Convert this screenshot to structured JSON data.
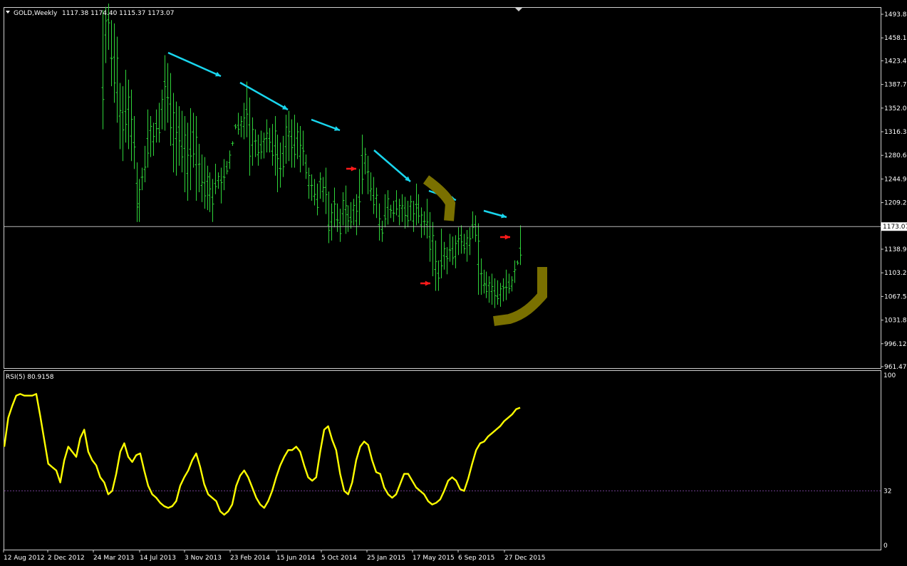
{
  "header": {
    "symbol": "GOLD,Weekly",
    "ohlc": "1117.38 1174.40 1115.37 1173.07"
  },
  "colors": {
    "background": "#000000",
    "bars": "#2fd43a",
    "trend_arrows": "#19d6ee",
    "signal_arrows": "#ff1a1a",
    "highlight_shapes": "#7a7000",
    "rsi_line": "#ffff00",
    "level_line": "#6a3a8a",
    "price_line": "#b8b8b8",
    "frame": "#cfcfcf"
  },
  "price_panel": {
    "current_price_label": "1173.07",
    "icons": [
      "dropdown-triangle-icon",
      "scroll-marker-icon"
    ]
  },
  "rsi_panel": {
    "title": "RSI(5) 80.9158"
  },
  "x_axis_labels": [
    "12 Aug 2012",
    "2 Dec 2012",
    "24 Mar 2013",
    "14 Jul 2013",
    "3 Nov 2013",
    "23 Feb 2014",
    "15 Jun 2014",
    "5 Oct 2014",
    "25 Jan 2015",
    "17 May 2015",
    "6 Sep 2015",
    "27 Dec 2015"
  ],
  "chart_data": [
    {
      "type": "bar",
      "title": "GOLD,Weekly",
      "subtitle": "1117.38 1174.40 1115.37 1173.07",
      "y_ticks": [
        "1493.82",
        "1458.12",
        "1423.47",
        "1387.75",
        "1352.07",
        "1316.37",
        "1280.67",
        "1244.97",
        "1209.27",
        "1173.07",
        "1138.92",
        "1103.22",
        "1067.52",
        "1031.82",
        "996.12",
        "961.47"
      ],
      "ylim": [
        961.47,
        1493.82
      ],
      "current_price": 1173.07,
      "grid": false,
      "x_start_label": "12 Aug 2012",
      "x_end_label": "27 Dec 2015",
      "highs": [
        1500,
        1505,
        1510,
        1485,
        1480,
        1460,
        1390,
        1385,
        1410,
        1395,
        1380,
        1340,
        1270,
        1245,
        1262,
        1295,
        1350,
        1340,
        1330,
        1350,
        1360,
        1380,
        1432,
        1420,
        1405,
        1375,
        1362,
        1355,
        1348,
        1340,
        1330,
        1352,
        1345,
        1340,
        1298,
        1282,
        1278,
        1265,
        1255,
        1245,
        1268,
        1255,
        1262,
        1275,
        1272,
        1288,
        1302,
        1328,
        1345,
        1340,
        1360,
        1392,
        1368,
        1338,
        1320,
        1312,
        1318,
        1315,
        1335,
        1322,
        1328,
        1340,
        1312,
        1300,
        1310,
        1342,
        1348,
        1335,
        1342,
        1330,
        1325,
        1318,
        1282,
        1262,
        1252,
        1245,
        1238,
        1255,
        1248,
        1262,
        1226,
        1208,
        1232,
        1208,
        1200,
        1225,
        1235,
        1205,
        1210,
        1215,
        1222,
        1260,
        1312,
        1292,
        1280,
        1255,
        1248,
        1232,
        1208,
        1182,
        1222,
        1228,
        1206,
        1212,
        1228,
        1215,
        1222,
        1218,
        1212,
        1220,
        1212,
        1238,
        1222,
        1202,
        1196,
        1215,
        1195,
        1180,
        1152,
        1122,
        1170,
        1150,
        1142,
        1162,
        1158,
        1160,
        1172,
        1175,
        1162,
        1168,
        1172,
        1196,
        1190,
        1178,
        1125,
        1108,
        1105,
        1098,
        1102,
        1095,
        1092,
        1088,
        1095,
        1108,
        1102,
        1098,
        1122,
        1122,
        1175
      ],
      "lows": [
        1320,
        1420,
        1440,
        1385,
        1360,
        1330,
        1290,
        1272,
        1300,
        1290,
        1272,
        1260,
        1180,
        1180,
        1228,
        1240,
        1262,
        1278,
        1280,
        1300,
        1300,
        1320,
        1318,
        1330,
        1295,
        1255,
        1250,
        1265,
        1255,
        1225,
        1212,
        1228,
        1262,
        1212,
        1225,
        1210,
        1200,
        1198,
        1195,
        1180,
        1222,
        1230,
        1208,
        1228,
        1252,
        1260,
        1295,
        1320,
        1312,
        1308,
        1305,
        1308,
        1250,
        1265,
        1278,
        1265,
        1275,
        1276,
        1285,
        1285,
        1265,
        1250,
        1225,
        1232,
        1248,
        1268,
        1272,
        1262,
        1262,
        1275,
        1255,
        1265,
        1245,
        1215,
        1212,
        1205,
        1190,
        1215,
        1210,
        1192,
        1148,
        1152,
        1172,
        1165,
        1150,
        1175,
        1162,
        1165,
        1170,
        1175,
        1160,
        1175,
        1222,
        1252,
        1222,
        1212,
        1192,
        1186,
        1152,
        1150,
        1172,
        1176,
        1186,
        1180,
        1190,
        1175,
        1180,
        1170,
        1172,
        1182,
        1165,
        1175,
        1178,
        1156,
        1160,
        1155,
        1120,
        1098,
        1076,
        1076,
        1095,
        1108,
        1101,
        1120,
        1115,
        1110,
        1130,
        1132,
        1132,
        1120,
        1130,
        1155,
        1150,
        1070,
        1070,
        1072,
        1065,
        1058,
        1055,
        1050,
        1055,
        1052,
        1060,
        1062,
        1072,
        1075,
        1088,
        1115,
        1115
      ]
    },
    {
      "type": "line",
      "title": "RSI(5) 80.9158",
      "y_ticks": [
        "100",
        "32",
        "0"
      ],
      "ylim": [
        0,
        100
      ],
      "level": 32,
      "last_value": 80.9158,
      "values": [
        58,
        75,
        82,
        88,
        89,
        88,
        88,
        88,
        89,
        76,
        62,
        48,
        46,
        44,
        37,
        50,
        58,
        55,
        52,
        63,
        68,
        55,
        50,
        47,
        40,
        37,
        30,
        32,
        42,
        55,
        60,
        52,
        49,
        53,
        54,
        44,
        35,
        30,
        28,
        25,
        23,
        22,
        23,
        26,
        35,
        40,
        44,
        50,
        54,
        46,
        36,
        30,
        28,
        26,
        20,
        18,
        20,
        24,
        35,
        41,
        44,
        40,
        34,
        28,
        24,
        22,
        26,
        32,
        40,
        47,
        52,
        56,
        56,
        58,
        55,
        47,
        40,
        38,
        40,
        55,
        68,
        70,
        62,
        56,
        42,
        32,
        30,
        37,
        50,
        58,
        61,
        59,
        50,
        43,
        42,
        34,
        30,
        28,
        30,
        36,
        42,
        42,
        38,
        34,
        32,
        30,
        26,
        24,
        25,
        27,
        32,
        38,
        40,
        38,
        33,
        32,
        39,
        48,
        56,
        60,
        61,
        64,
        66,
        68,
        70,
        73,
        75,
        77,
        80,
        80.9
      ]
    }
  ]
}
